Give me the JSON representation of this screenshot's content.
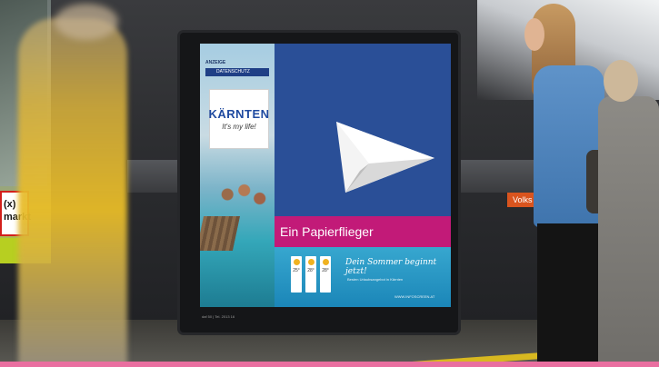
{
  "left_poster": {
    "logo_text": "(x)\nmarkt"
  },
  "billboard": {
    "anzeige": "ANZEIGE",
    "datenschutz": "DATENSCHUTZ",
    "brand": "KÄRNTEN",
    "tagline": "It's my life!",
    "headline": "Ein Papierflieger",
    "slogan": "Dein Sommer beginnt jetzt!",
    "slogan_sub": "Besten Urlaubsangebot in Kärnten",
    "url": "WWW.INFOSCREEN.AT",
    "frame_caption": "daf 50 | Tel. 2013 16",
    "weather": [
      {
        "temp": "25°"
      },
      {
        "temp": "28°"
      },
      {
        "temp": "28°"
      }
    ]
  },
  "station_sign": "Volks",
  "colors": {
    "ad_blue": "#2a4f97",
    "ad_pink": "#c21a78",
    "lime": "#b7cf21",
    "sign_orange": "#d9541e"
  }
}
